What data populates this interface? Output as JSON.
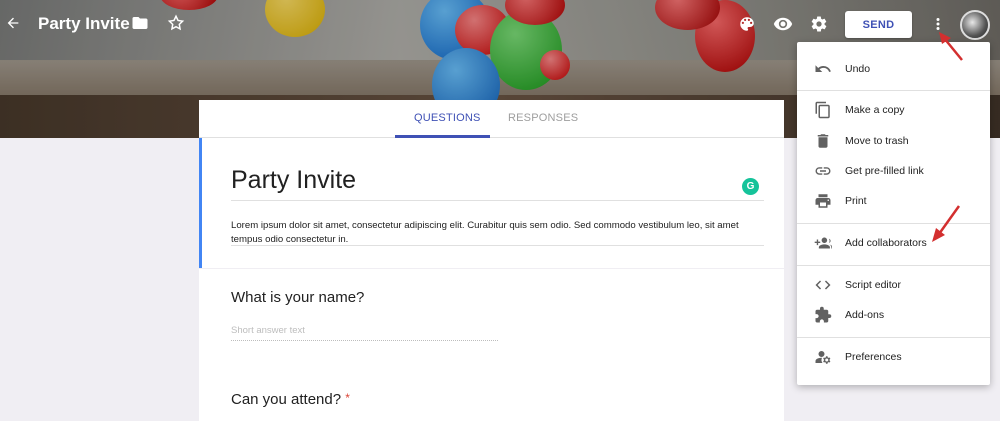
{
  "header": {
    "title": "Party Invite",
    "send_label": "SEND",
    "icons": [
      "back-arrow-icon",
      "folder-icon",
      "star-icon",
      "palette-icon",
      "preview-eye-icon",
      "settings-gear-icon",
      "more-vert-icon"
    ]
  },
  "tabs": [
    {
      "label": "QUESTIONS",
      "active": true
    },
    {
      "label": "RESPONSES",
      "active": false
    }
  ],
  "form": {
    "title": "Party Invite",
    "description": "Lorem ipsum dolor sit amet, consectetur adipiscing elit. Curabitur quis sem odio. Sed commodo vestibulum leo, sit amet tempus odio consectetur in.",
    "questions": [
      {
        "text": "What is your name?",
        "placeholder": "Short answer text",
        "required": false
      },
      {
        "text": "Can you attend?",
        "required": true,
        "required_mark": "*"
      }
    ]
  },
  "menu": {
    "items": [
      {
        "label": "Undo",
        "icon": "undo-icon"
      },
      {
        "label": "Make a copy",
        "icon": "copy-icon"
      },
      {
        "label": "Move to trash",
        "icon": "trash-icon"
      },
      {
        "label": "Get pre-filled link",
        "icon": "link-icon"
      },
      {
        "label": "Print",
        "icon": "print-icon"
      },
      {
        "label": "Add collaborators",
        "icon": "add-people-icon"
      },
      {
        "label": "Script editor",
        "icon": "code-icon"
      },
      {
        "label": "Add-ons",
        "icon": "puzzle-icon"
      },
      {
        "label": "Preferences",
        "icon": "person-settings-icon"
      }
    ]
  },
  "colors": {
    "accent": "#3f51b5",
    "annotation_arrow": "#d32f2f",
    "description_bar": "#4285f4",
    "required": "#db4437"
  }
}
